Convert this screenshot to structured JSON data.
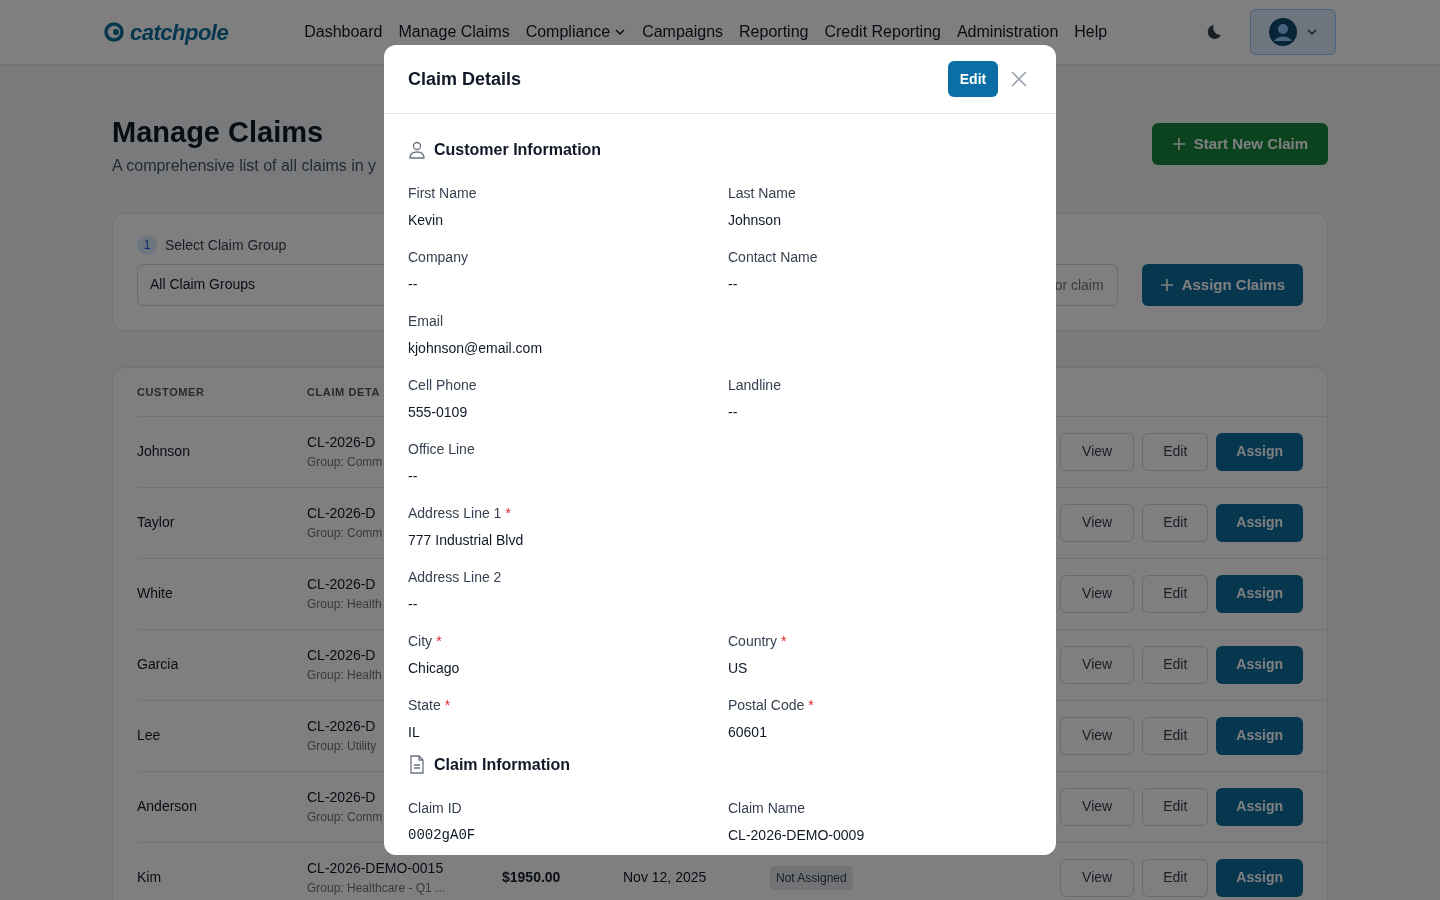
{
  "navbar": {
    "brand": "catchpole",
    "links": [
      {
        "label": "Dashboard",
        "dropdown": false
      },
      {
        "label": "Manage Claims",
        "dropdown": false
      },
      {
        "label": "Compliance",
        "dropdown": true
      },
      {
        "label": "Campaigns",
        "dropdown": false
      },
      {
        "label": "Reporting",
        "dropdown": false
      },
      {
        "label": "Credit Reporting",
        "dropdown": false
      },
      {
        "label": "Administration",
        "dropdown": false
      },
      {
        "label": "Help",
        "dropdown": false
      }
    ]
  },
  "page": {
    "title": "Manage Claims",
    "subtitle": "A comprehensive list of all claims in y",
    "primary_button": "Start New Claim"
  },
  "filter": {
    "step": "1",
    "label": "Select Claim Group",
    "select_value": "All Claim Groups",
    "search": {
      "placeholder": "or claim"
    },
    "button": "Assign Claims"
  },
  "table": {
    "columns": [
      "CUSTOMER",
      "CLAIM DETA"
    ],
    "rows": [
      {
        "customer": "Johnson",
        "claim": "CL-2026-D",
        "group": "Group: Comm",
        "actions": [
          "View",
          "Edit",
          "Assign"
        ]
      },
      {
        "customer": "Taylor",
        "claim": "CL-2026-D",
        "group": "Group: Comm",
        "actions": [
          "View",
          "Edit",
          "Assign"
        ]
      },
      {
        "customer": "White",
        "claim": "CL-2026-D",
        "group": "Group: Health",
        "actions": [
          "View",
          "Edit",
          "Assign"
        ]
      },
      {
        "customer": "Garcia",
        "claim": "CL-2026-D",
        "group": "Group: Health",
        "actions": [
          "View",
          "Edit",
          "Assign"
        ]
      },
      {
        "customer": "Lee",
        "claim": "CL-2026-D",
        "group": "Group: Utility",
        "actions": [
          "View",
          "Edit",
          "Assign"
        ]
      },
      {
        "customer": "Anderson",
        "claim": "CL-2026-D",
        "group": "Group: Comm",
        "actions": [
          "View",
          "Edit",
          "Assign"
        ]
      },
      {
        "customer": "Kim",
        "claim": "CL-2026-DEMO-0015",
        "group": "Group: Healthcare - Q1 ...",
        "amount": "$1950.00",
        "date": "Nov 12, 2025",
        "status": "Not Assigned",
        "actions": [
          "View",
          "Edit",
          "Assign"
        ]
      }
    ]
  },
  "modal": {
    "title": "Claim Details",
    "edit_button": "Edit",
    "sections": [
      {
        "title": "Customer Information",
        "rows": [
          [
            {
              "label": "First Name",
              "value": "Kevin"
            },
            {
              "label": "Last Name",
              "value": "Johnson"
            }
          ],
          [
            {
              "label": "Company",
              "value": "--"
            },
            {
              "label": "Contact Name",
              "value": "--"
            }
          ],
          [
            {
              "label": "Email",
              "value": "kjohnson@email.com"
            }
          ],
          [
            {
              "label": "Cell Phone",
              "value": "555-0109"
            },
            {
              "label": "Landline",
              "value": "--"
            }
          ],
          [
            {
              "label": "Office Line",
              "value": "--"
            }
          ],
          [
            {
              "label": "Address Line 1",
              "required_mark": "*",
              "value": "777 Industrial Blvd"
            }
          ],
          [
            {
              "label": "Address Line 2",
              "value": "--"
            }
          ],
          [
            {
              "label": "City",
              "required_mark": "*",
              "value": "Chicago"
            },
            {
              "label": "Country",
              "required_mark": "*",
              "value": "US"
            }
          ],
          [
            {
              "label": "State",
              "required_mark": "*",
              "value": "IL"
            },
            {
              "label": "Postal Code",
              "required_mark": "*",
              "value": "60601"
            }
          ]
        ]
      },
      {
        "title": "Claim Information",
        "rows": [
          [
            {
              "label": "Claim ID",
              "value": "0002gA0F",
              "kind": "code"
            },
            {
              "label": "Claim Name",
              "value": "CL-2026-DEMO-0009"
            }
          ]
        ]
      }
    ]
  }
}
